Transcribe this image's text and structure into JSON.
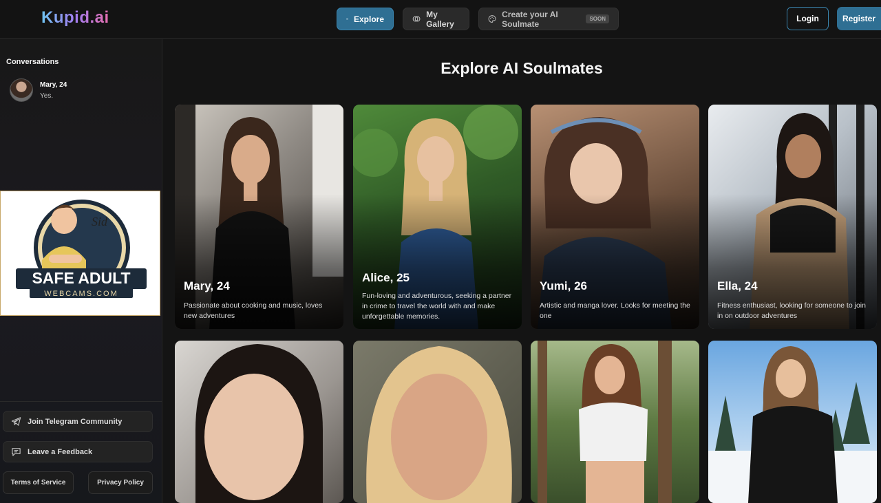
{
  "header": {
    "logo": "Kupid.ai",
    "nav": {
      "explore": "Explore",
      "gallery": "My Gallery",
      "create": "Create your AI Soulmate",
      "soon_badge": "SOON"
    },
    "login": "Login",
    "register": "Register"
  },
  "sidebar": {
    "conversations_title": "Conversations",
    "conversation": {
      "name": "Mary, 24",
      "last_message": "Yes."
    },
    "sponsor": {
      "brand_line1": "SAFE ADULT",
      "brand_line2": "WEBCAMS.COM",
      "signature": "Sid"
    },
    "telegram": "Join Telegram Community",
    "feedback": "Leave a Feedback",
    "terms": "Terms of Service",
    "privacy": "Privacy Policy"
  },
  "main": {
    "title": "Explore AI Soulmates",
    "cards": [
      {
        "name": "Mary, 24",
        "desc": "Passionate about cooking and music, loves new adventures"
      },
      {
        "name": "Alice, 25",
        "desc": "Fun-loving and adventurous, seeking a partner in crime to travel the world with and make unforgettable memories."
      },
      {
        "name": "Yumi, 26",
        "desc": "Artistic and manga lover. Looks for meeting the one"
      },
      {
        "name": "Ella, 24",
        "desc": "Fitness enthusiast, looking for someone to join in on outdoor adventures"
      }
    ]
  },
  "colors": {
    "accent": "#2f6f93",
    "background": "#141414",
    "sidebar": "#181818"
  }
}
